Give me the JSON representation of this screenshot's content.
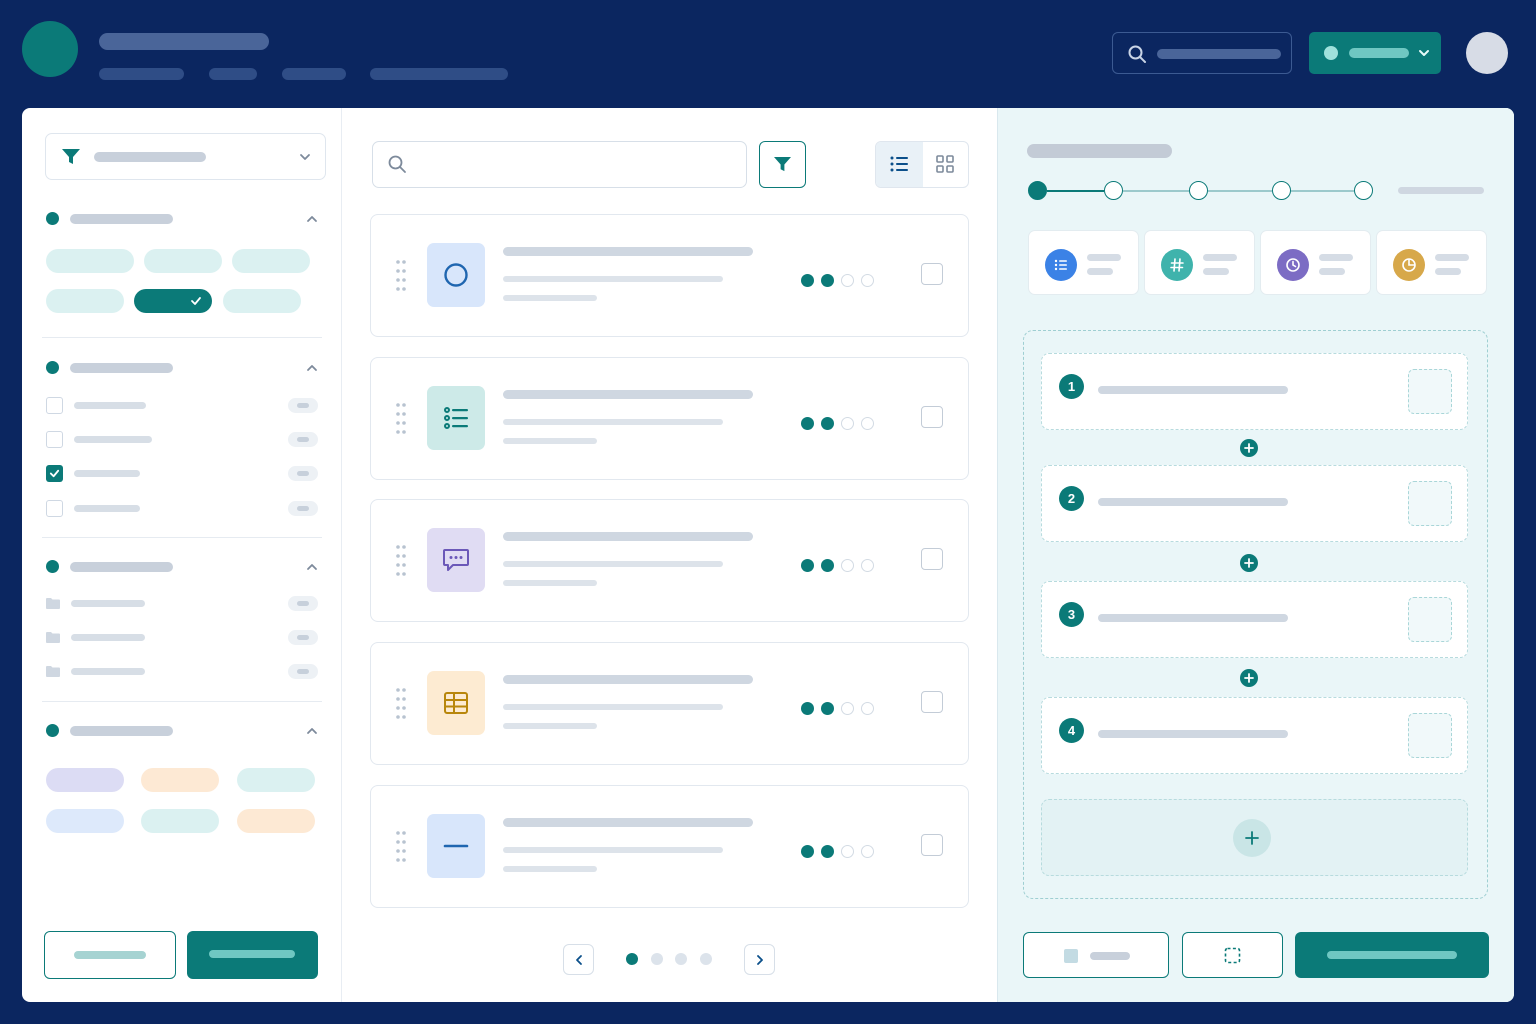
{
  "colors": {
    "background": "#0b2660",
    "accent": "#0b7a78",
    "header_placeholder": "#4a6599",
    "avatar": "#d7dce6",
    "chip_mint": "#dbf1f1",
    "chip_lavender": "#dcdcf4",
    "chip_peach": "#fde9d4",
    "chip_sky": "#dde9fb",
    "placeholder_text": "#c8d0db",
    "icon_blue": "#3b82e6",
    "icon_teal": "#3fb3ac",
    "icon_purple": "#7c6cc4",
    "icon_gold": "#d7a84a"
  },
  "icons": {
    "top_search": "search-icon",
    "workspace": "chevron-down-icon",
    "filter": "filter-icon",
    "list_view": "list-view-icon",
    "grid_view": "grid-view-icon",
    "items": [
      "circle-icon",
      "checklist-icon",
      "chat-icon",
      "table-icon",
      "minus-icon"
    ],
    "stats": [
      "list-icon",
      "hash-icon",
      "clock-icon",
      "pie-chart-icon"
    ],
    "pagination_prev": "chevron-left-icon",
    "pagination_next": "chevron-right-icon",
    "add": "plus-icon"
  },
  "left": {
    "sections": [
      {
        "kind": "chips",
        "selected_chip": 4
      },
      {
        "kind": "checkbox-list",
        "rows": [
          {
            "checked": false
          },
          {
            "checked": false
          },
          {
            "checked": true
          },
          {
            "checked": false
          }
        ]
      },
      {
        "kind": "folder-list",
        "rows": 3
      },
      {
        "kind": "color-chips"
      }
    ]
  },
  "center": {
    "items": [
      {
        "progress_filled": 2,
        "progress_total": 4
      },
      {
        "progress_filled": 2,
        "progress_total": 4
      },
      {
        "progress_filled": 2,
        "progress_total": 4
      },
      {
        "progress_filled": 2,
        "progress_total": 4
      },
      {
        "progress_filled": 2,
        "progress_total": 4
      }
    ],
    "pagination": {
      "current_page": 1,
      "total_pages": 4
    }
  },
  "right": {
    "stepper": {
      "current_step": 1,
      "total_steps": 5
    },
    "flow_steps": [
      "1",
      "2",
      "3",
      "4"
    ]
  }
}
